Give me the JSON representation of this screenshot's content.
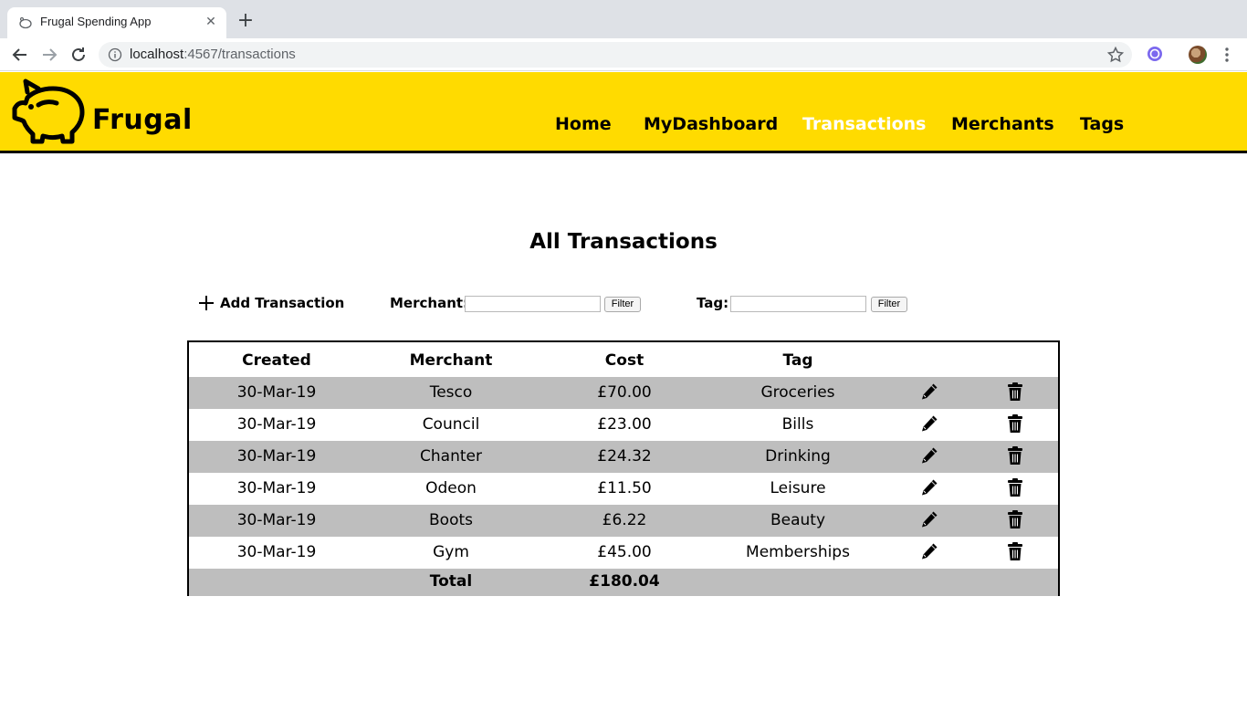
{
  "browser": {
    "tab_title": "Frugal Spending App",
    "url_host": "localhost",
    "url_rest": ":4567/transactions"
  },
  "header": {
    "brand": "Frugal",
    "nav": [
      "Home",
      "MyDashboard",
      "Transactions",
      "Merchants",
      "Tags"
    ],
    "active_nav": "Transactions",
    "colors": {
      "accent": "#ffdb00",
      "active_text": "#ffffff"
    }
  },
  "main": {
    "title": "All Transactions",
    "add_label": "Add Transaction",
    "merchant_filter_label": "Merchant:",
    "tag_filter_label": "Tag:",
    "filter_button_label": "Filter",
    "merchant_filter_value": "",
    "tag_filter_value": ""
  },
  "table": {
    "headers": [
      "Created",
      "Merchant",
      "Cost",
      "Tag"
    ],
    "rows": [
      [
        "30-Mar-19",
        "Tesco",
        "£70.00",
        "Groceries"
      ],
      [
        "30-Mar-19",
        "Council",
        "£23.00",
        "Bills"
      ],
      [
        "30-Mar-19",
        "Chanter",
        "£24.32",
        "Drinking"
      ],
      [
        "30-Mar-19",
        "Odeon",
        "£11.50",
        "Leisure"
      ],
      [
        "30-Mar-19",
        "Boots",
        "£6.22",
        "Beauty"
      ],
      [
        "30-Mar-19",
        "Gym",
        "£45.00",
        "Memberships"
      ]
    ],
    "total_label": "Total",
    "total_value": "£180.04",
    "row_icons": [
      "pencil-icon",
      "trash-icon"
    ],
    "stripe_color": "#bebebe"
  }
}
